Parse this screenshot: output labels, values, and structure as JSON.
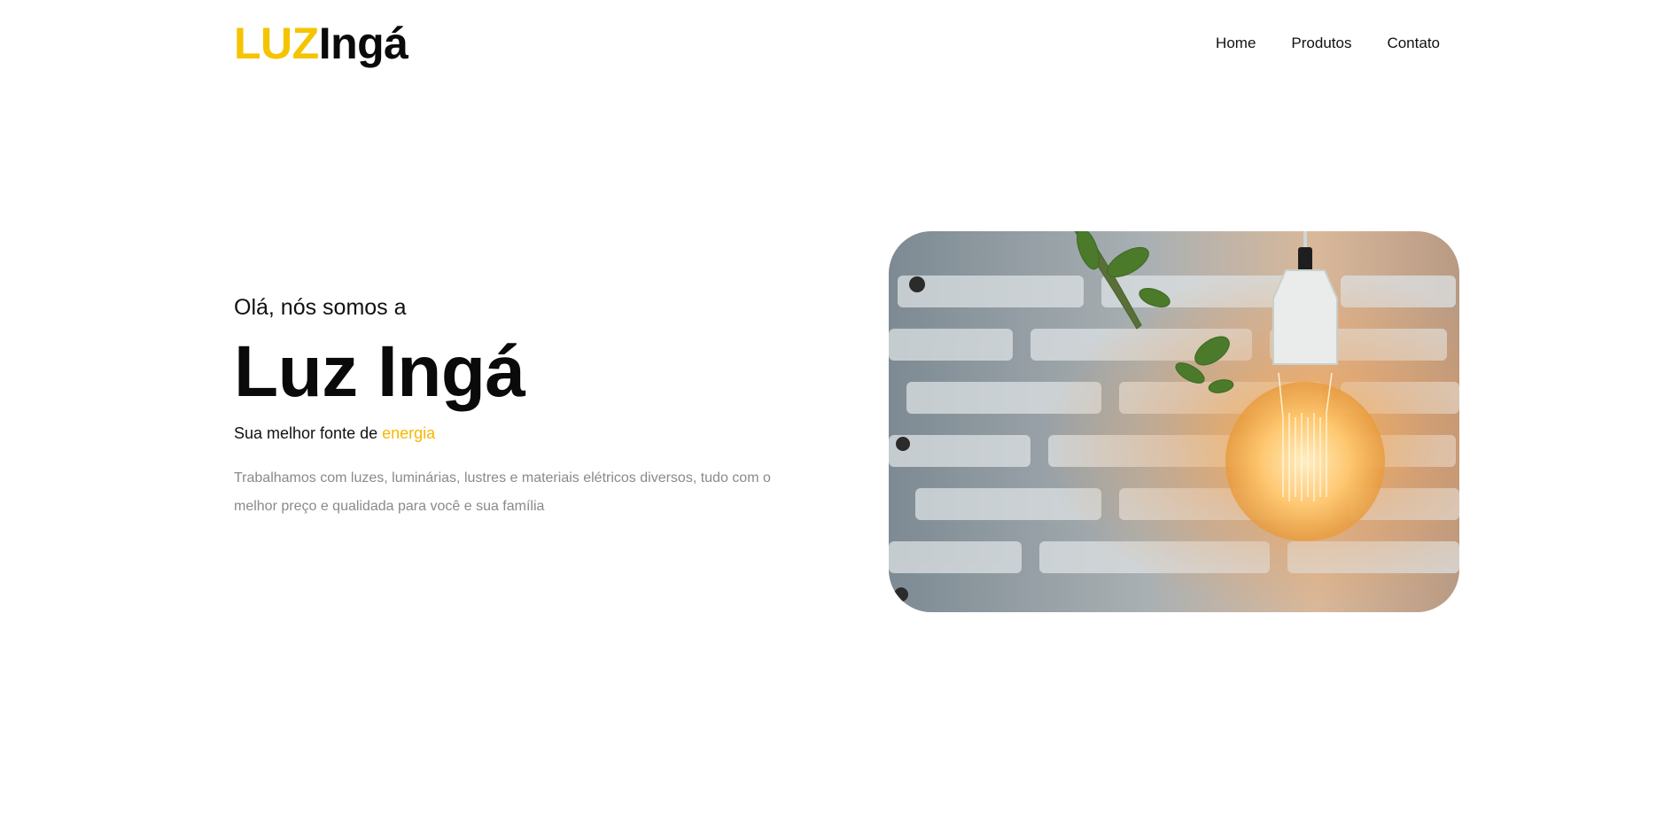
{
  "logo": {
    "accent": "LUZ",
    "rest": "Ingá"
  },
  "nav": {
    "items": [
      "Home",
      "Produtos",
      "Contato"
    ]
  },
  "hero": {
    "greeting": "Olá, nós somos a",
    "headline": "Luz Ingá",
    "tagline_prefix": "Sua melhor fonte de ",
    "tagline_highlight": "energia",
    "description": "Trabalhamos com luzes, luminárias, lustres e materiais elétricos diversos, tudo com o melhor preço e qualidada para você e sua família"
  },
  "colors": {
    "accent": "#f5c400",
    "text": "#111111",
    "muted": "#8a8a8a",
    "background": "#ffffff"
  },
  "image": {
    "subject": "light-bulb-photo"
  }
}
